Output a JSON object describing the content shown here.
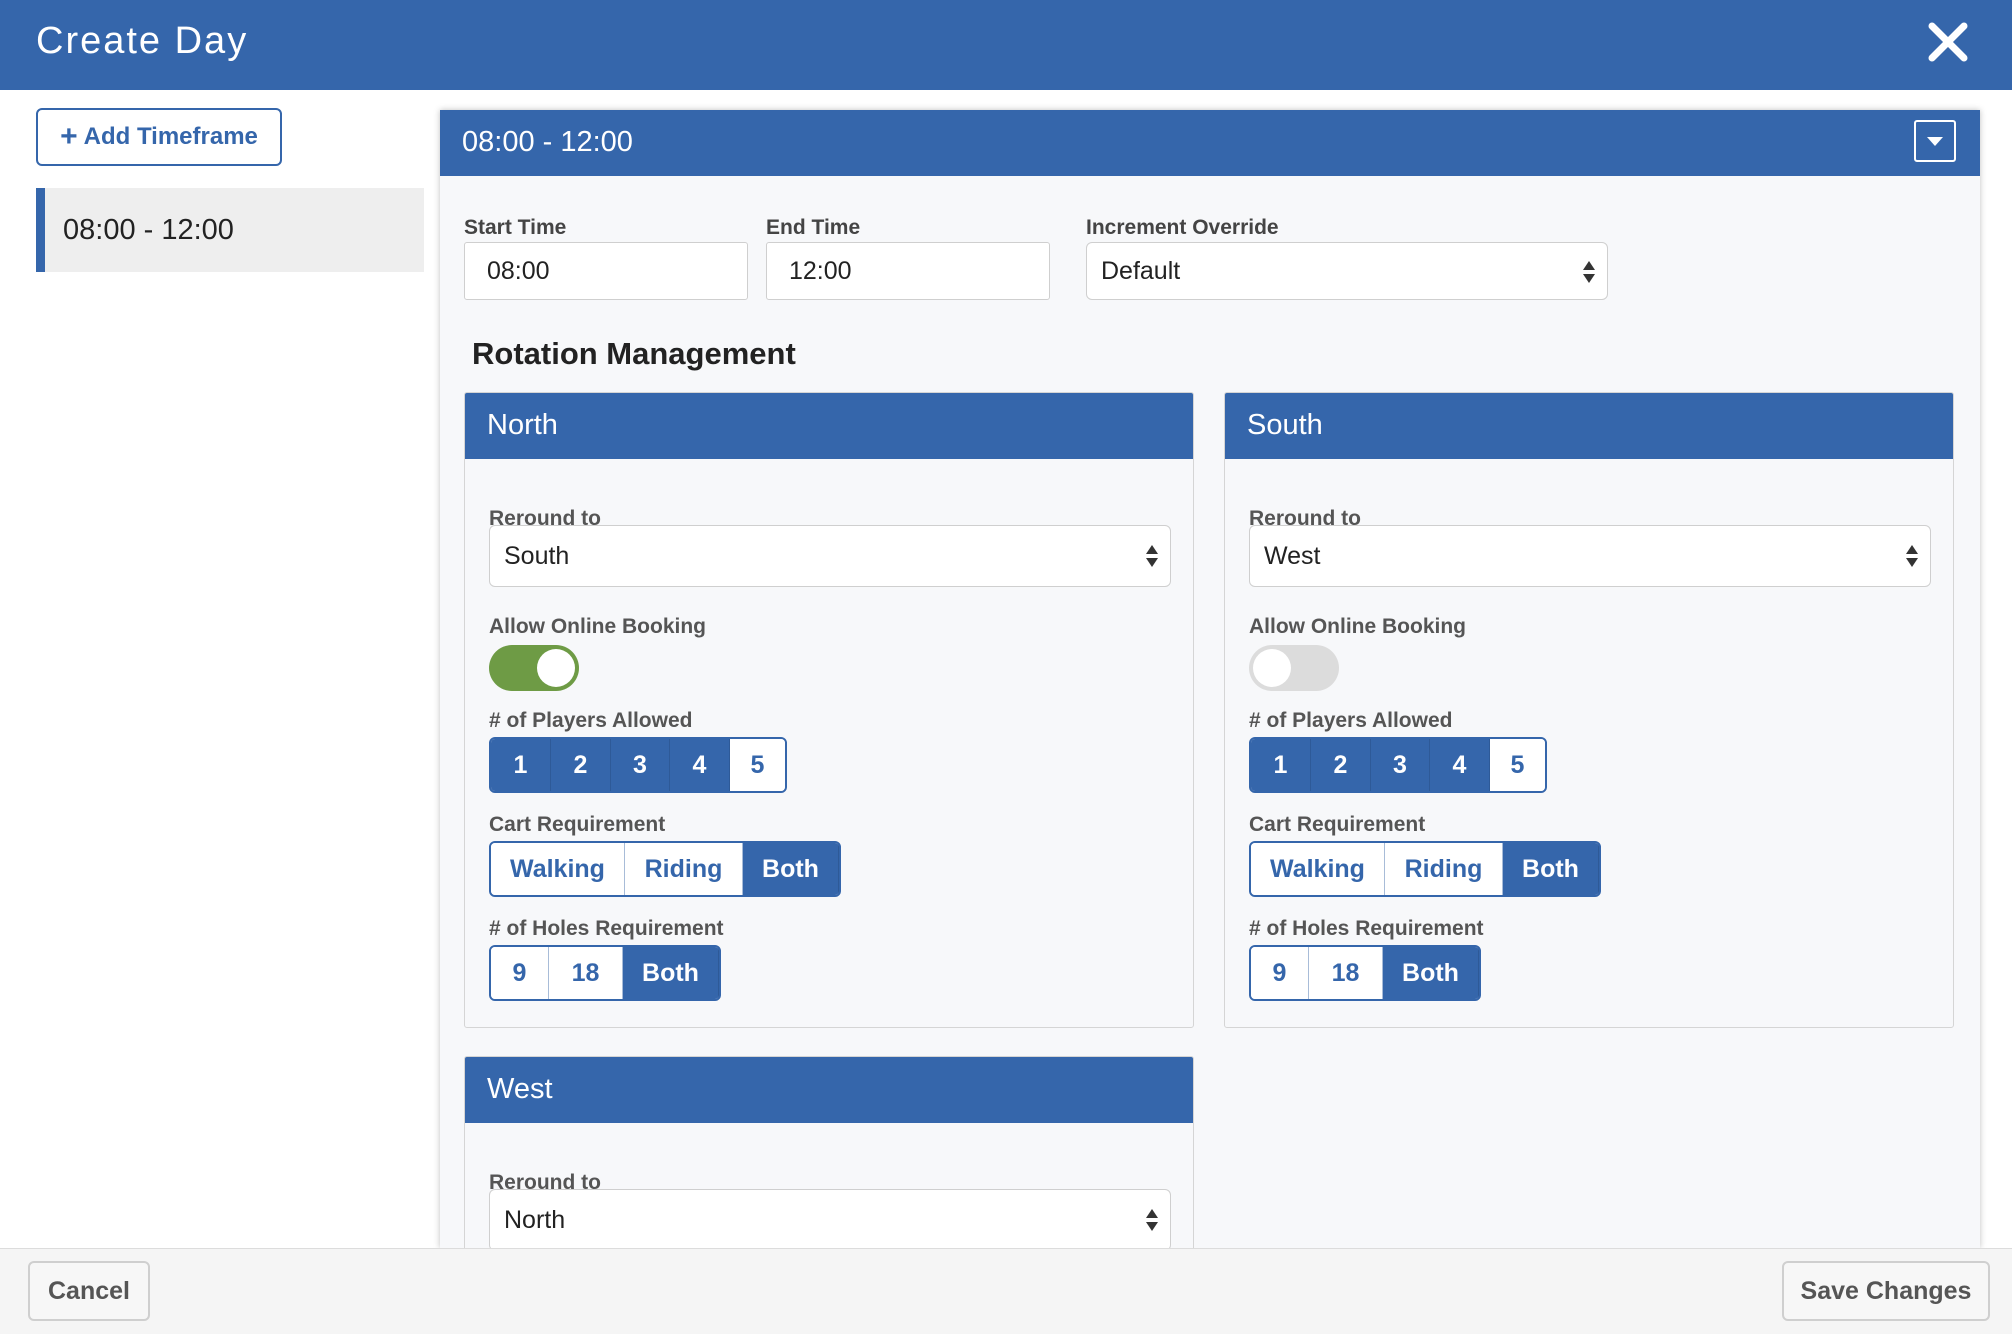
{
  "header": {
    "title": "Create Day"
  },
  "sidebar": {
    "add_label": "Add Timeframe",
    "timeframes": [
      {
        "label": "08:00 - 12:00"
      }
    ]
  },
  "timeframe": {
    "title": "08:00 - 12:00",
    "start_time": {
      "label": "Start Time",
      "value": "08:00"
    },
    "end_time": {
      "label": "End Time",
      "value": "12:00"
    },
    "increment_override": {
      "label": "Increment Override",
      "value": "Default"
    }
  },
  "rotation": {
    "title": "Rotation Management",
    "labels": {
      "reround": "Reround to",
      "online_booking": "Allow Online Booking",
      "players": "# of Players Allowed",
      "cart": "Cart Requirement",
      "holes": "# of Holes Requirement"
    },
    "player_options": [
      "1",
      "2",
      "3",
      "4",
      "5"
    ],
    "cart_options": [
      "Walking",
      "Riding",
      "Both"
    ],
    "hole_options": [
      "9",
      "18",
      "Both"
    ],
    "courses": [
      {
        "name": "North",
        "reround_to": "South",
        "online_booking": true,
        "players_selected": [
          "1",
          "2",
          "3",
          "4"
        ],
        "cart_selected": "Both",
        "holes_selected": "Both"
      },
      {
        "name": "South",
        "reround_to": "West",
        "online_booking": false,
        "players_selected": [
          "1",
          "2",
          "3",
          "4"
        ],
        "cart_selected": "Both",
        "holes_selected": "Both"
      },
      {
        "name": "West",
        "reround_to": "North"
      }
    ]
  },
  "footer": {
    "cancel_label": "Cancel",
    "save_label": "Save Changes"
  },
  "colors": {
    "primary": "#3566ab",
    "toggle_on": "#6e9b45",
    "toggle_off": "#dcdcdc"
  }
}
